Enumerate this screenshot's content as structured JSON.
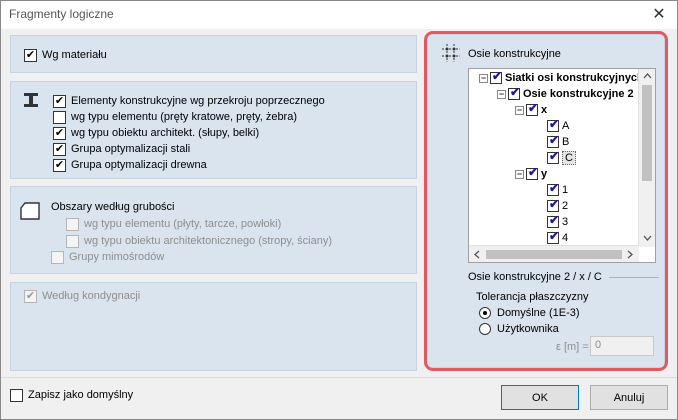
{
  "window": {
    "title": "Fragmenty logiczne",
    "close_glyph": "✕"
  },
  "panel_material": {
    "label": "Wg materiału",
    "checked": true
  },
  "panel_elements": {
    "items": [
      {
        "label": "Elementy konstrukcyjne wg przekroju poprzecznego",
        "checked": true
      },
      {
        "label": "wg typu elementu (pręty kratowe, pręty, żebra)",
        "checked": false
      },
      {
        "label": "wg typu obiektu architekt. (słupy, belki)",
        "checked": true
      },
      {
        "label": "Grupa optymalizacji stali",
        "checked": true
      },
      {
        "label": "Grupa optymalizacji drewna",
        "checked": true
      }
    ]
  },
  "panel_thickness": {
    "title": "Obszary według grubości",
    "items": [
      {
        "label": "wg typu elementu (płyty, tarcze, powłoki)"
      },
      {
        "label": "wg typu obiektu architektonicznego (stropy, ściany)"
      },
      {
        "label": "Grupy mimośrodów"
      }
    ]
  },
  "panel_storey": {
    "label": "Według kondygnacji",
    "checked": true
  },
  "axes_panel": {
    "title": "Osie konstrukcyjne",
    "tree": {
      "root": "Siatki osi konstrukcyjnych",
      "grid": "Osie konstrukcyjne 2",
      "x": "x",
      "x_items": [
        "A",
        "B",
        "C"
      ],
      "y": "y",
      "y_items": [
        "1",
        "2",
        "3",
        "4"
      ]
    },
    "section_label": "Osie konstrukcyjne 2 / x / C",
    "tolerance_title": "Tolerancja płaszczyzny",
    "radio_default": "Domyślne (1E-3)",
    "radio_user": "Użytkownika",
    "eps_label": "ε [m] =",
    "eps_value": "0"
  },
  "footer": {
    "save_default": "Zapisz jako domyślny",
    "ok": "OK",
    "cancel": "Anuluj"
  }
}
